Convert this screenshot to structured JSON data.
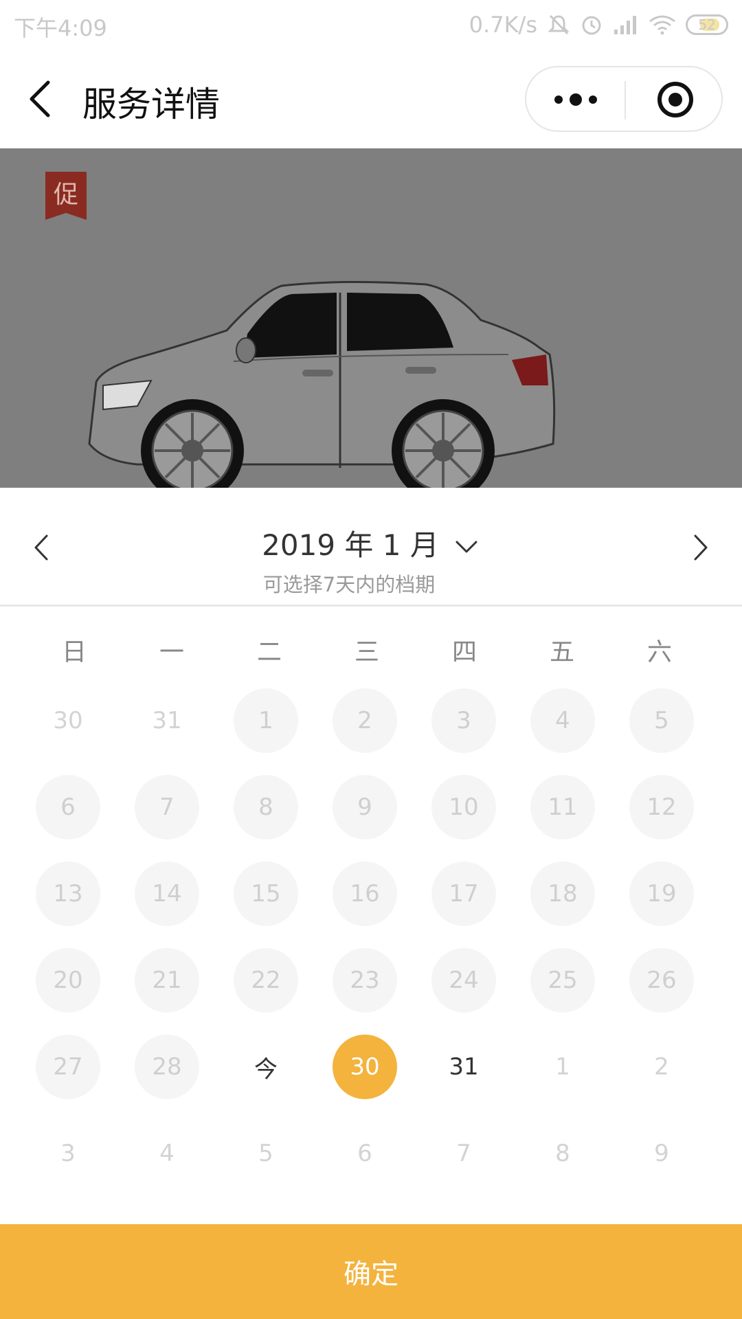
{
  "status_bar": {
    "time": "下午4:09",
    "speed": "0.7K/s",
    "battery": "52",
    "icons": [
      "mute-icon",
      "alarm-icon",
      "signal-icon",
      "wifi-icon",
      "battery-icon"
    ]
  },
  "nav": {
    "title": "服务详情"
  },
  "banner": {
    "promo_tag": "促",
    "image": "car-illustration"
  },
  "calendar": {
    "month_title": "2019 年 1 月",
    "subtitle": "可选择7天内的档期",
    "weekdays": [
      "日",
      "一",
      "二",
      "三",
      "四",
      "五",
      "六"
    ],
    "weeks": [
      [
        {
          "label": "30",
          "state": "other"
        },
        {
          "label": "31",
          "state": "other"
        },
        {
          "label": "1",
          "state": "disabled"
        },
        {
          "label": "2",
          "state": "disabled"
        },
        {
          "label": "3",
          "state": "disabled"
        },
        {
          "label": "4",
          "state": "disabled"
        },
        {
          "label": "5",
          "state": "disabled"
        }
      ],
      [
        {
          "label": "6",
          "state": "disabled"
        },
        {
          "label": "7",
          "state": "disabled"
        },
        {
          "label": "8",
          "state": "disabled"
        },
        {
          "label": "9",
          "state": "disabled"
        },
        {
          "label": "10",
          "state": "disabled"
        },
        {
          "label": "11",
          "state": "disabled"
        },
        {
          "label": "12",
          "state": "disabled"
        }
      ],
      [
        {
          "label": "13",
          "state": "disabled"
        },
        {
          "label": "14",
          "state": "disabled"
        },
        {
          "label": "15",
          "state": "disabled"
        },
        {
          "label": "16",
          "state": "disabled"
        },
        {
          "label": "17",
          "state": "disabled"
        },
        {
          "label": "18",
          "state": "disabled"
        },
        {
          "label": "19",
          "state": "disabled"
        }
      ],
      [
        {
          "label": "20",
          "state": "disabled"
        },
        {
          "label": "21",
          "state": "disabled"
        },
        {
          "label": "22",
          "state": "disabled"
        },
        {
          "label": "23",
          "state": "disabled"
        },
        {
          "label": "24",
          "state": "disabled"
        },
        {
          "label": "25",
          "state": "disabled"
        },
        {
          "label": "26",
          "state": "disabled"
        }
      ],
      [
        {
          "label": "27",
          "state": "disabled"
        },
        {
          "label": "28",
          "state": "disabled"
        },
        {
          "label": "今",
          "state": "available"
        },
        {
          "label": "30",
          "state": "selected"
        },
        {
          "label": "31",
          "state": "available"
        },
        {
          "label": "1",
          "state": "other"
        },
        {
          "label": "2",
          "state": "other"
        }
      ],
      [
        {
          "label": "3",
          "state": "other"
        },
        {
          "label": "4",
          "state": "other"
        },
        {
          "label": "5",
          "state": "other"
        },
        {
          "label": "6",
          "state": "other"
        },
        {
          "label": "7",
          "state": "other"
        },
        {
          "label": "8",
          "state": "other"
        },
        {
          "label": "9",
          "state": "other"
        }
      ]
    ],
    "selected_color": "#f3b33d"
  },
  "confirm_label": "确定"
}
